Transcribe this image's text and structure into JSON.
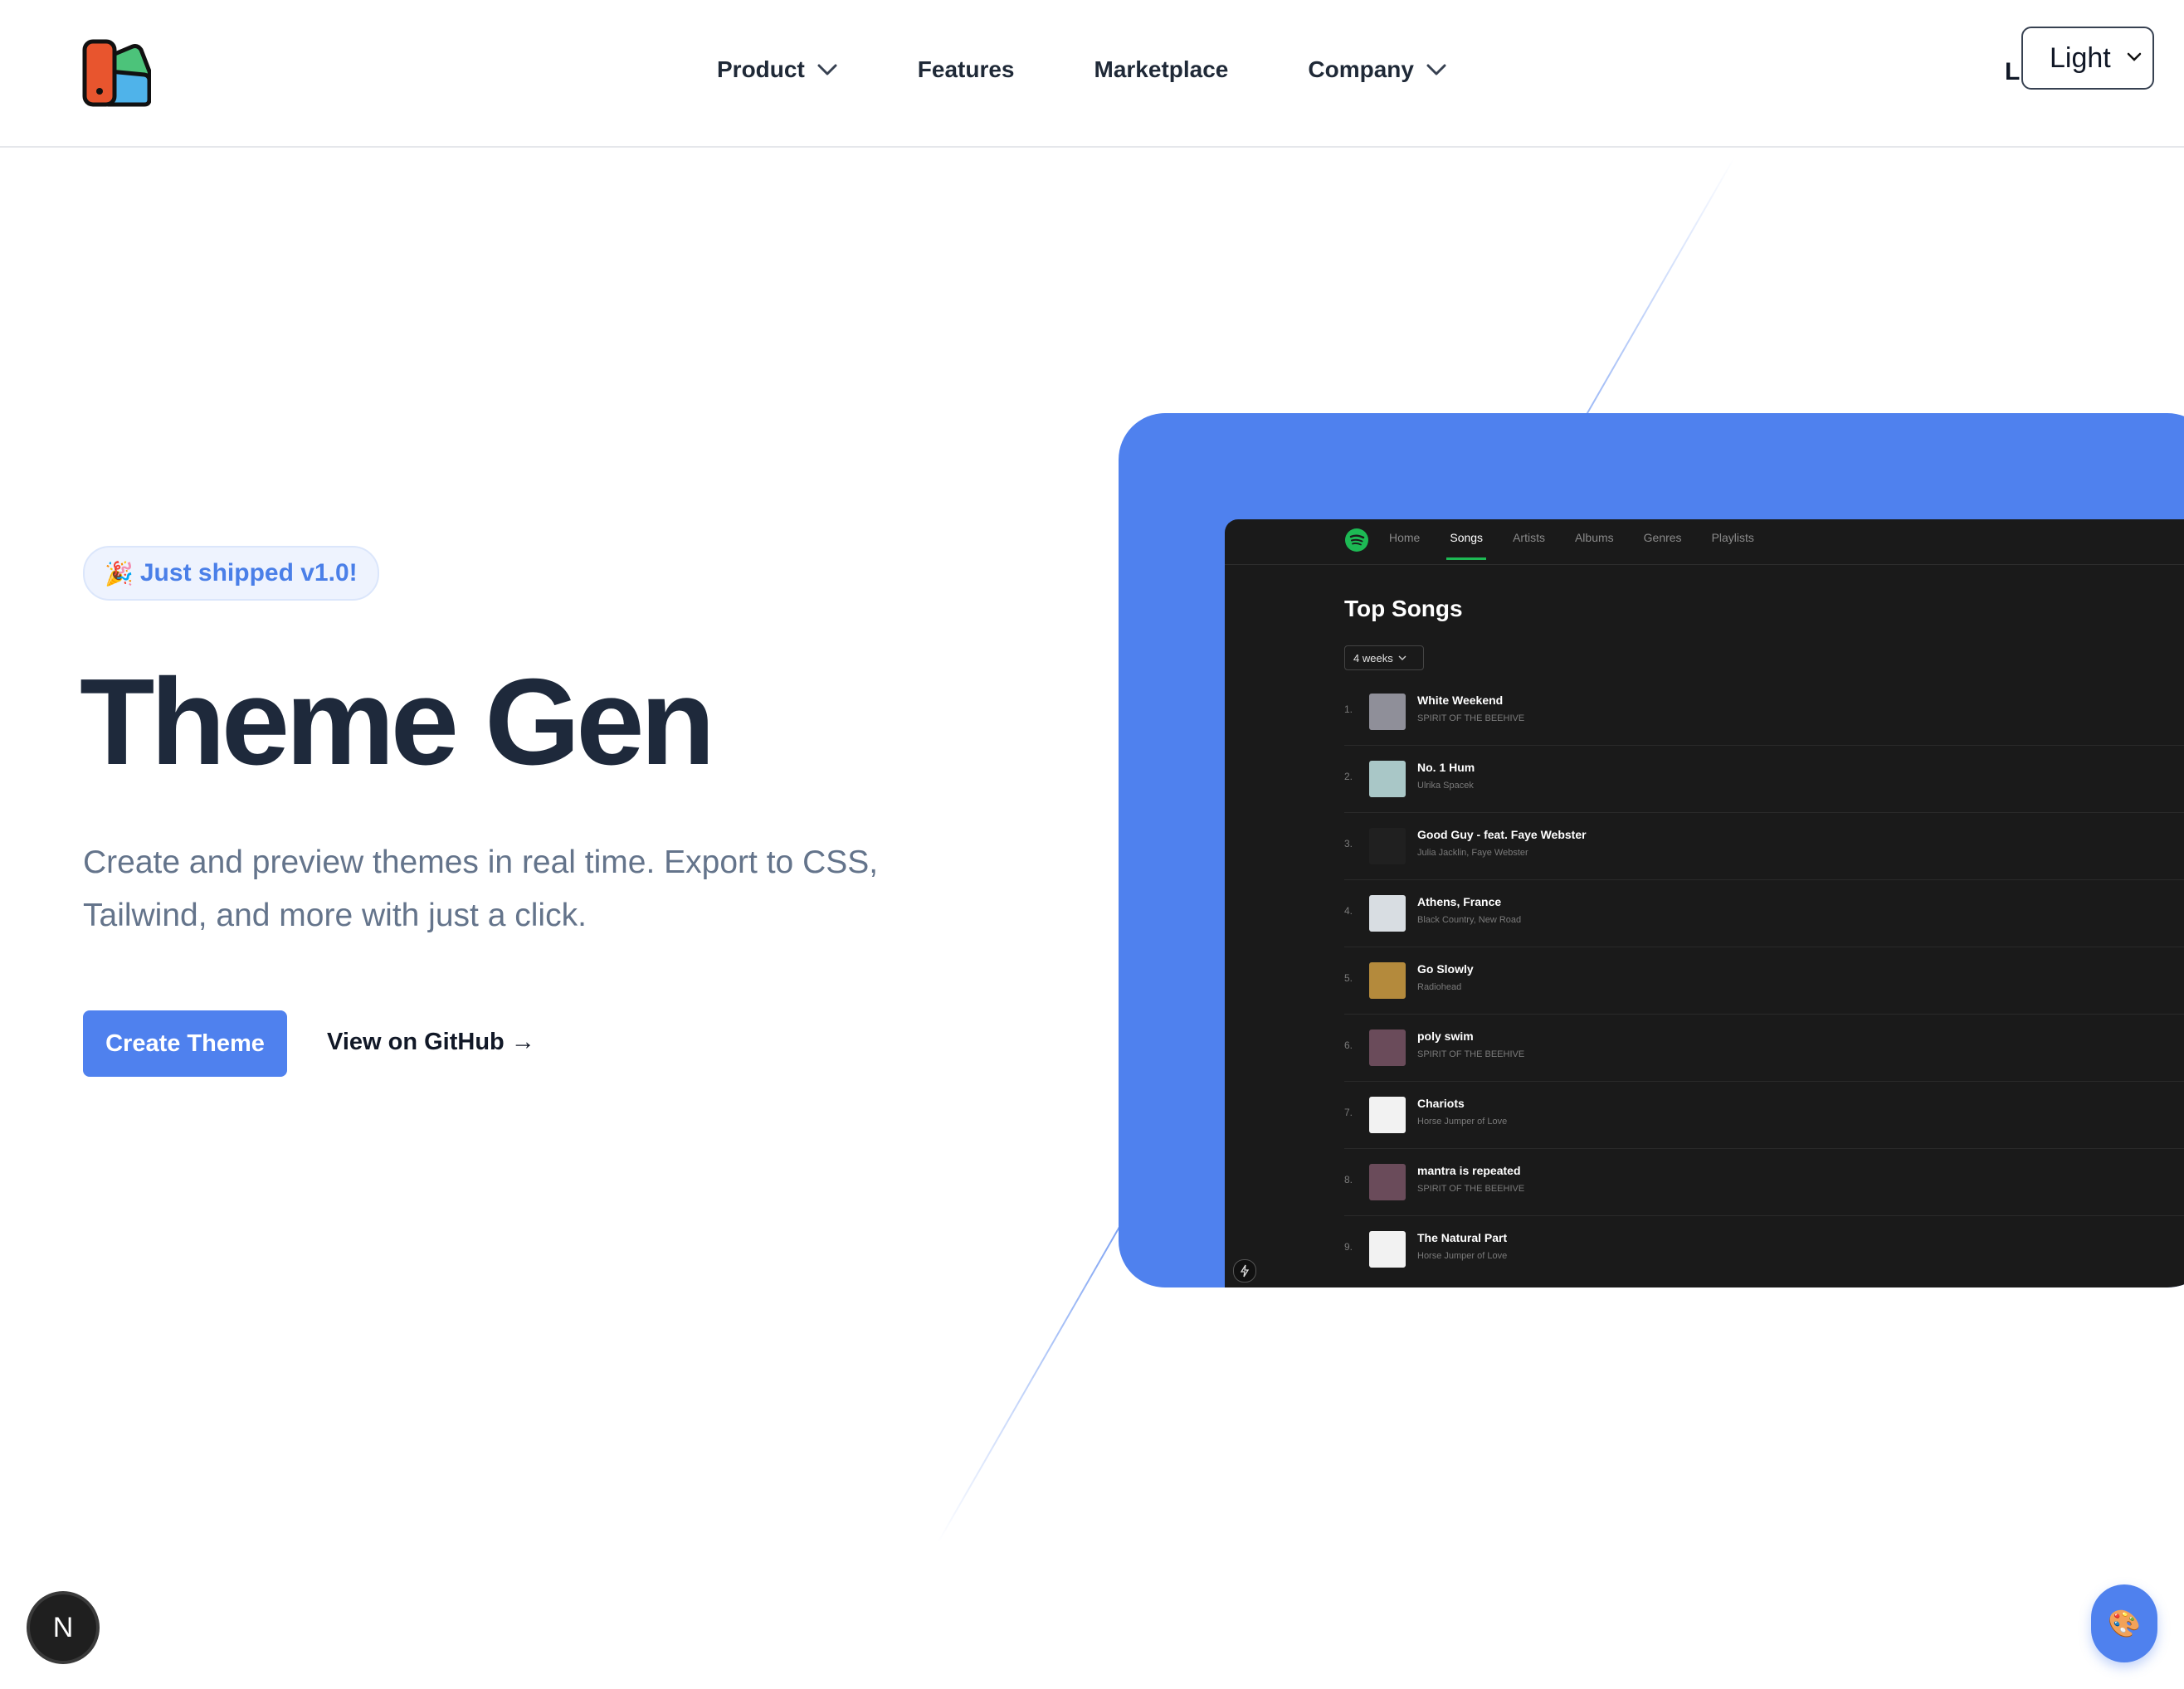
{
  "header": {
    "nav": [
      {
        "label": "Product",
        "dropdown": true
      },
      {
        "label": "Features",
        "dropdown": false
      },
      {
        "label": "Marketplace",
        "dropdown": false
      },
      {
        "label": "Company",
        "dropdown": true
      }
    ],
    "login_partial": "L",
    "theme_select": {
      "value": "Light",
      "options": [
        "Light"
      ]
    }
  },
  "hero": {
    "badge_emoji": "🎉",
    "badge_text": "Just shipped v1.0!",
    "title": "Theme Gen",
    "subtitle": "Create and preview themes in real time. Export to CSS, Tailwind, and more with just a click.",
    "primary_button": "Create Theme",
    "secondary_link": "View on GitHub →"
  },
  "preview": {
    "tabs": [
      "Home",
      "Songs",
      "Artists",
      "Albums",
      "Genres",
      "Playlists"
    ],
    "active_tab": "Songs",
    "heading": "Top Songs",
    "range": "4 weeks",
    "songs": [
      {
        "n": "1.",
        "title": "White Weekend",
        "artist": "SPIRIT OF THE BEEHIVE",
        "art": "#8f8f99"
      },
      {
        "n": "2.",
        "title": "No. 1 Hum",
        "artist": "Ulrika Spacek",
        "art": "#a9c7c7"
      },
      {
        "n": "3.",
        "title": "Good Guy - feat. Faye Webster",
        "artist": "Julia Jacklin, Faye Webster",
        "art": "#202020"
      },
      {
        "n": "4.",
        "title": "Athens, France",
        "artist": "Black Country, New Road",
        "art": "#d8dde2"
      },
      {
        "n": "5.",
        "title": "Go Slowly",
        "artist": "Radiohead",
        "art": "#b48a3c"
      },
      {
        "n": "6.",
        "title": "poly swim",
        "artist": "SPIRIT OF THE BEEHIVE",
        "art": "#6a4b5a"
      },
      {
        "n": "7.",
        "title": "Chariots",
        "artist": "Horse Jumper of Love",
        "art": "#f2f2f2"
      },
      {
        "n": "8.",
        "title": "mantra is repeated",
        "artist": "SPIRIT OF THE BEEHIVE",
        "art": "#6a4b5a"
      },
      {
        "n": "9.",
        "title": "The Natural Part",
        "artist": "Horse Jumper of Love",
        "art": "#f2f2f2"
      }
    ]
  },
  "floating": {
    "next_label": "N",
    "palette_emoji": "🎨"
  },
  "colors": {
    "accent": "#4f81ee",
    "title": "#1e293b",
    "muted": "#64748b",
    "spotify_green": "#1db954"
  }
}
